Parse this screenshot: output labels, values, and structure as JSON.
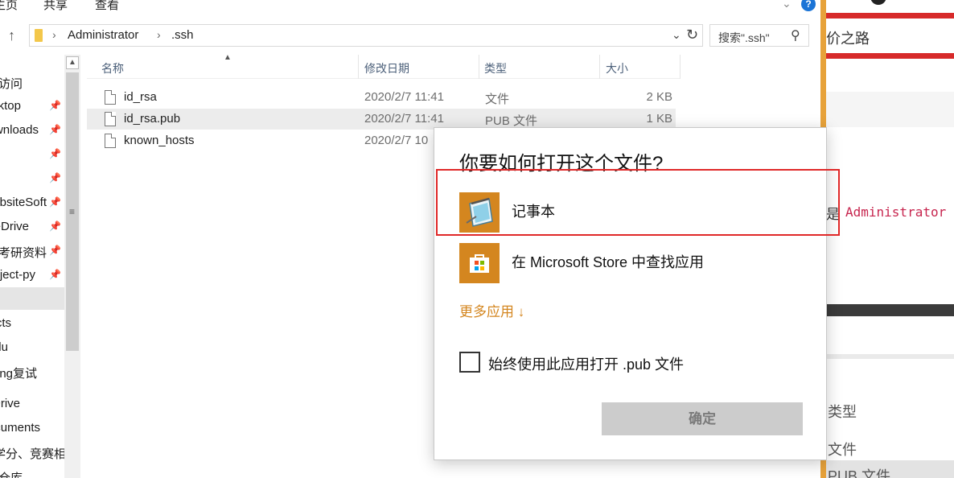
{
  "ribbon": {
    "tabs": [
      "主页",
      "共享",
      "查看"
    ],
    "expand_glyph": "⌄",
    "help_glyph": "?"
  },
  "address": {
    "crumbs": [
      "Administrator",
      ".ssh"
    ],
    "search_placeholder": "搜索\".ssh\""
  },
  "nav": {
    "items": [
      {
        "label": "访问",
        "pinned": false
      },
      {
        "label": "Desktop",
        "pinned": true
      },
      {
        "label": "Downloads",
        "pinned": true
      },
      {
        "label": "",
        "pinned": true
      },
      {
        "label": "",
        "pinned": true
      },
      {
        "label": "WebsiteSoft",
        "pinned": true
      },
      {
        "label": "OneDrive",
        "pinned": true
      },
      {
        "label": "考研资料",
        "pinned": true
      },
      {
        "label": "project-py",
        "pinned": true
      },
      {
        "label": "",
        "pinned": false
      },
      {
        "label": "Objects",
        "pinned": false
      },
      {
        "label": "Baidu",
        "pinned": false
      },
      {
        "label": "Beijing复试",
        "pinned": false
      },
      {
        "label": "",
        "pinned": false
      },
      {
        "label": "OneDrive",
        "pinned": false
      },
      {
        "label": "Documents",
        "pinned": false
      },
      {
        "label": "学分、竞赛相",
        "pinned": false
      },
      {
        "label": "代码仓库",
        "pinned": false
      }
    ]
  },
  "columns": {
    "name": "名称",
    "modified": "修改日期",
    "type": "类型",
    "size": "大小"
  },
  "files": [
    {
      "name": "id_rsa",
      "date": "2020/2/7 11:41",
      "type": "文件",
      "size": "2 KB"
    },
    {
      "name": "id_rsa.pub",
      "date": "2020/2/7 11:41",
      "type": "PUB 文件",
      "size": "1 KB"
    },
    {
      "name": "known_hosts",
      "date": "2020/2/7 10",
      "type": "",
      "size": ""
    }
  ],
  "background_page": {
    "heading_fragment": "价之路",
    "code_prefix": "是",
    "code_text": "Administrator",
    "type_label": "类型",
    "file_label": "文件",
    "pub_label": "PUB 文件"
  },
  "dialog": {
    "title": "你要如何打开这个文件?",
    "apps": [
      {
        "name": "记事本",
        "icon": "notepad-icon"
      },
      {
        "name": "在 Microsoft Store 中查找应用",
        "icon": "store-icon"
      }
    ],
    "more_apps": "更多应用 ↓",
    "always_use": "始终使用此应用打开 .pub 文件",
    "always_checked": false,
    "ok_label": "确定"
  },
  "colors": {
    "accent": "#d4861f",
    "highlight_box": "#e02828",
    "button_disabled": "#cccccc"
  }
}
